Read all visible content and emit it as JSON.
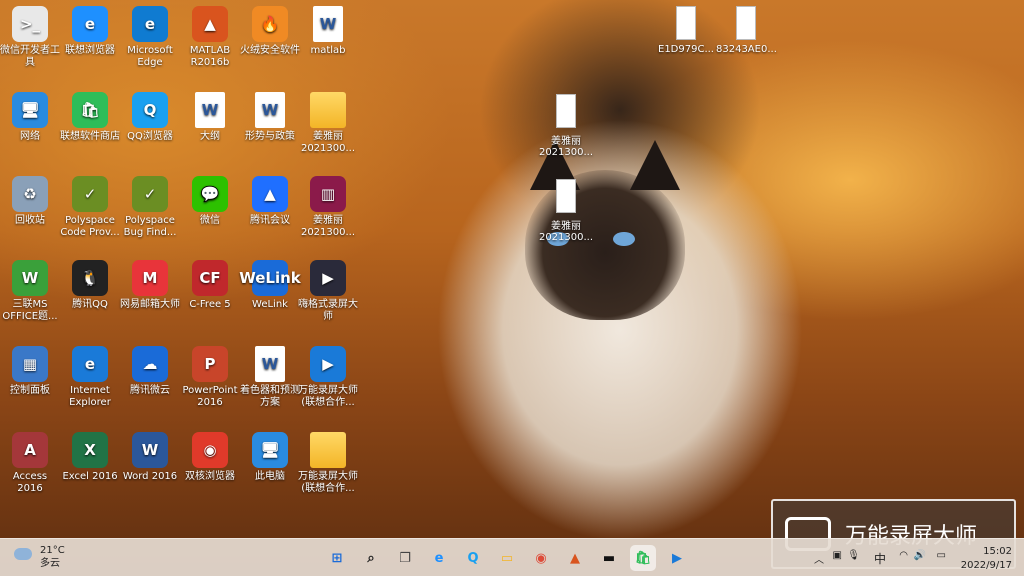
{
  "desktop": {
    "icons": [
      {
        "label": "微信开发者工具",
        "glyph": ">_",
        "color": "#e8e8e8"
      },
      {
        "label": "联想浏览器",
        "glyph": "e",
        "color": "#1e90ff"
      },
      {
        "label": "Microsoft Edge",
        "glyph": "e",
        "color": "#0f7bd1"
      },
      {
        "label": "MATLAB R2016b",
        "glyph": "▲",
        "color": "#d9541e"
      },
      {
        "label": "火绒安全软件",
        "glyph": "🔥",
        "color": "#f08a24"
      },
      {
        "label": "matlab",
        "glyph": "W",
        "color": "#2b579a"
      },
      {
        "label": "网络",
        "glyph": "🖥",
        "color": "#2a8be0"
      },
      {
        "label": "联想软件商店",
        "glyph": "🛍",
        "color": "#2ebd59"
      },
      {
        "label": "QQ浏览器",
        "glyph": "Q",
        "color": "#1aa0f0"
      },
      {
        "label": "大纲",
        "glyph": "W",
        "color": "#2b579a"
      },
      {
        "label": "形势与政策",
        "glyph": "W",
        "color": "#2b579a"
      },
      {
        "label": "姜雅丽 2021300...",
        "glyph": "",
        "color": "#f3b527"
      },
      {
        "label": "回收站",
        "glyph": "♻",
        "color": "#8aa0b8"
      },
      {
        "label": "Polyspace Code Prov...",
        "glyph": "✓",
        "color": "#6b8e23"
      },
      {
        "label": "Polyspace Bug Find...",
        "glyph": "✓",
        "color": "#6b8e23"
      },
      {
        "label": "微信",
        "glyph": "💬",
        "color": "#2dc100"
      },
      {
        "label": "腾讯会议",
        "glyph": "▲",
        "color": "#1f6fff"
      },
      {
        "label": "姜雅丽 2021300...",
        "glyph": "▥",
        "color": "#8b1a4a"
      },
      {
        "label": "三联MS OFFICE题...",
        "glyph": "W",
        "color": "#3aa03a"
      },
      {
        "label": "腾讯QQ",
        "glyph": "🐧",
        "color": "#222222"
      },
      {
        "label": "网易邮箱大师",
        "glyph": "M",
        "color": "#e8343a"
      },
      {
        "label": "C-Free 5",
        "glyph": "CF",
        "color": "#c0282c"
      },
      {
        "label": "WeLink",
        "glyph": "WeLink",
        "color": "#1a6bd8"
      },
      {
        "label": "嗨格式录屏大师",
        "glyph": "▶",
        "color": "#2a2a3a"
      },
      {
        "label": "控制面板",
        "glyph": "▦",
        "color": "#3a78c8"
      },
      {
        "label": "Internet Explorer",
        "glyph": "e",
        "color": "#1a7ad8"
      },
      {
        "label": "腾讯微云",
        "glyph": "☁",
        "color": "#1a6bd8"
      },
      {
        "label": "PowerPoint 2016",
        "glyph": "P",
        "color": "#c8452a"
      },
      {
        "label": "着色器和预测方案",
        "glyph": "W",
        "color": "#2b579a"
      },
      {
        "label": "万能录屏大师(联想合作...",
        "glyph": "▶",
        "color": "#1a7ad8"
      },
      {
        "label": "Access 2016",
        "glyph": "A",
        "color": "#a4373a"
      },
      {
        "label": "Excel 2016",
        "glyph": "X",
        "color": "#217346"
      },
      {
        "label": "Word 2016",
        "glyph": "W",
        "color": "#2b579a"
      },
      {
        "label": "双核浏览器",
        "glyph": "◉",
        "color": "#e03a2a"
      },
      {
        "label": "此电脑",
        "glyph": "🖥",
        "color": "#2a8be0"
      },
      {
        "label": "万能录屏大师(联想合作...",
        "glyph": "",
        "color": "#f3b527"
      }
    ],
    "files": [
      {
        "label": "E1D979C..."
      },
      {
        "label": "83243AE0..."
      },
      {
        "label": "姜雅丽 2021300..."
      },
      {
        "label": "姜雅丽 2021300..."
      }
    ]
  },
  "watermark": {
    "text": "万能录屏大师",
    "icon": "camera-icon"
  },
  "taskbar": {
    "weather": {
      "temp": "21°C",
      "desc": "多云"
    },
    "apps": [
      {
        "name": "start-icon",
        "glyph": "⊞",
        "color": "#1a6bd8"
      },
      {
        "name": "search-icon",
        "glyph": "⌕",
        "color": "#222222"
      },
      {
        "name": "task-view-icon",
        "glyph": "❐",
        "color": "#444444"
      },
      {
        "name": "edge-lenovo-icon",
        "glyph": "e",
        "color": "#1e90ff"
      },
      {
        "name": "qq-browser-icon",
        "glyph": "Q",
        "color": "#1aa0f0"
      },
      {
        "name": "file-explorer-icon",
        "glyph": "▭",
        "color": "#f3b527"
      },
      {
        "name": "chrome-icon",
        "glyph": "◉",
        "color": "#dd4b39"
      },
      {
        "name": "matlab-icon",
        "glyph": "▲",
        "color": "#d9541e"
      },
      {
        "name": "terminal-icon",
        "glyph": "▬",
        "color": "#111111"
      },
      {
        "name": "app-store-icon",
        "glyph": "🛍",
        "color": "#2ebd59"
      },
      {
        "name": "screen-recorder-icon",
        "glyph": "▶",
        "color": "#1a7ad8"
      }
    ],
    "tray": {
      "ime": "中",
      "time": "15:02",
      "date": "2022/9/17"
    }
  }
}
